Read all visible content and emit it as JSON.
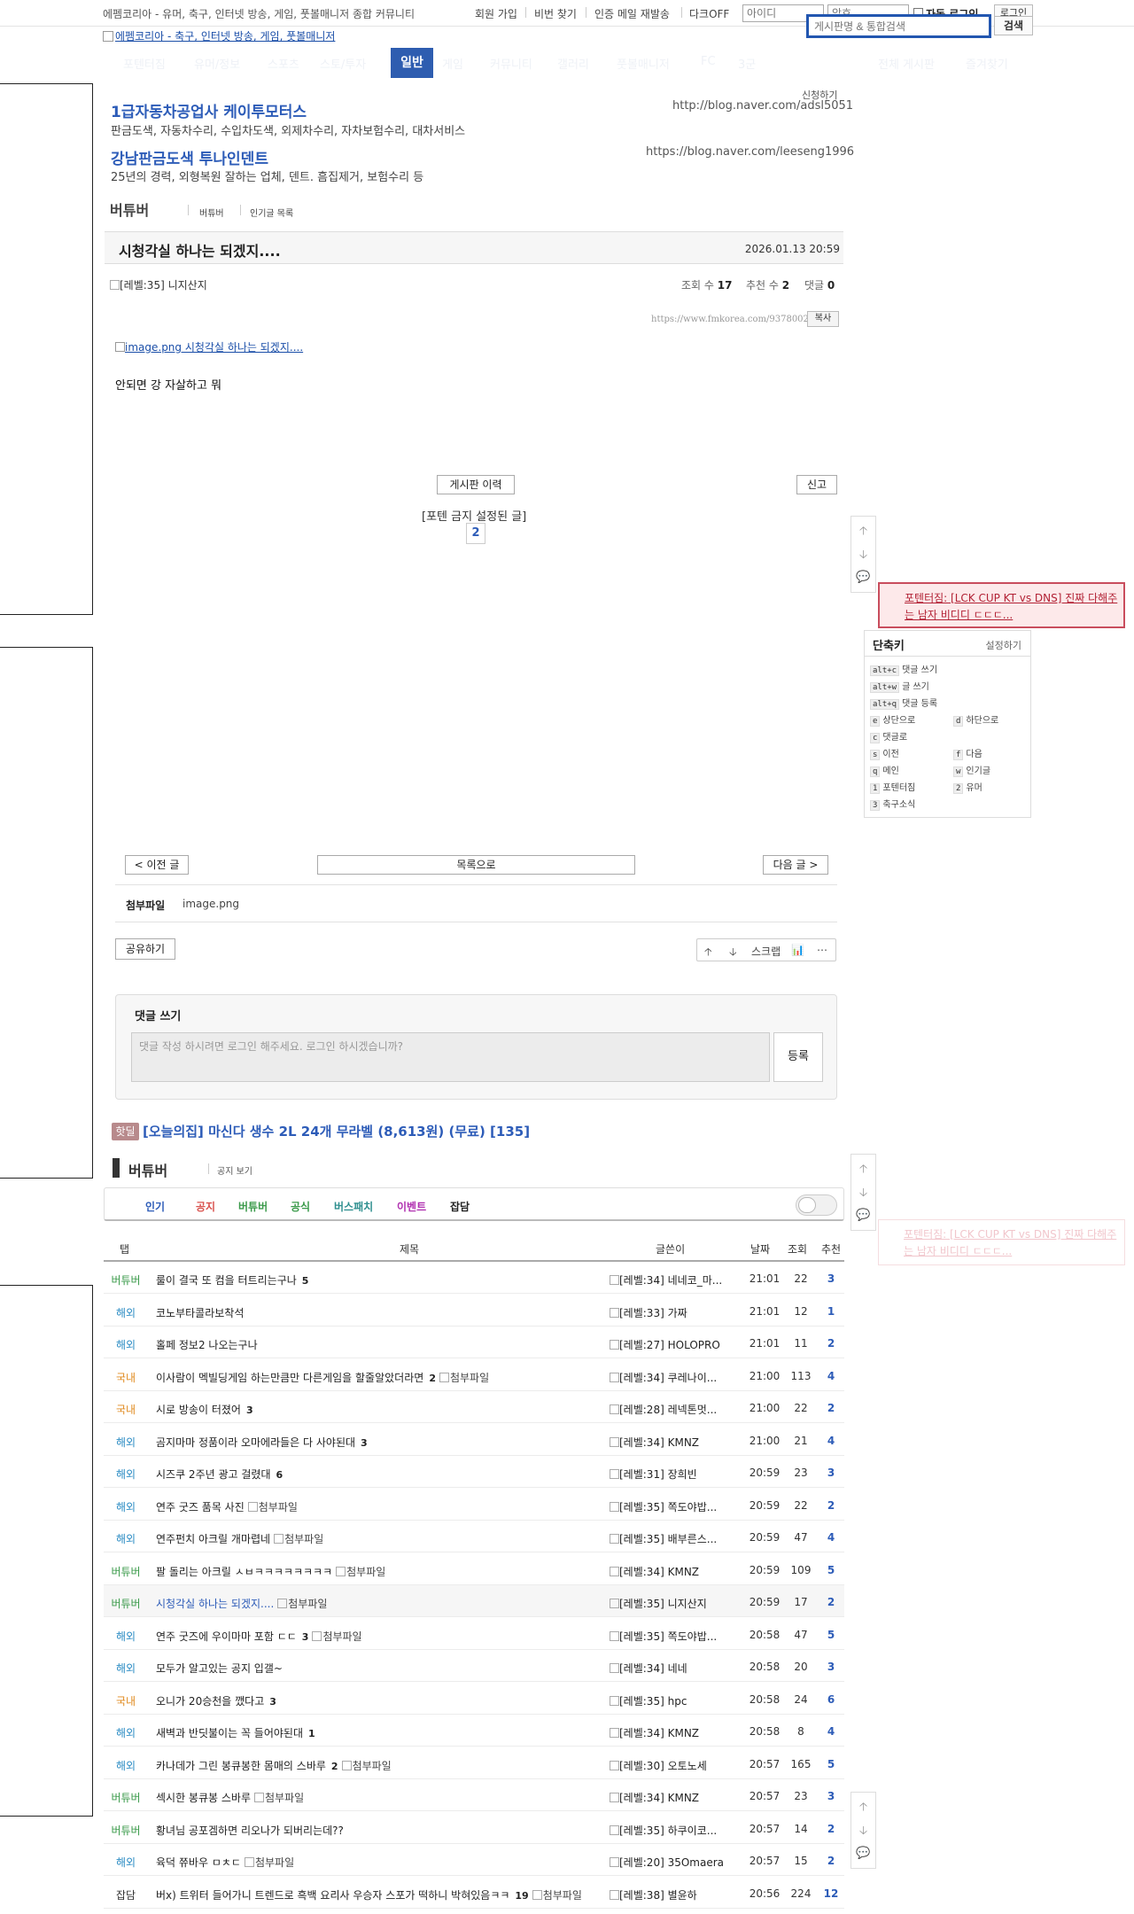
{
  "topbar": {
    "description": "에펨코리아 - 유머, 축구, 인터넷 방송, 게임, 풋볼매니저 종합 커뮤니티",
    "links": [
      "회원 가입",
      "비번 찾기",
      "인증 메일 재발송",
      "다크OFF"
    ],
    "id_placeholder": "아이디",
    "pw_placeholder": "암호",
    "autologin": "자동 로그인",
    "login": "로그인"
  },
  "logo": {
    "alt": "에펨코리아 - 축구, 인터넷 방송, 게임, 풋볼매니저"
  },
  "search": {
    "placeholder": "게시판명 & 통합검색",
    "button": "검색"
  },
  "nav": {
    "items": [
      "포텐터짐",
      "유머/정보",
      "스포츠",
      "스토/투자",
      "게임",
      "커뮤니티",
      "갤러리",
      "풋볼매니저",
      "FC",
      "3군"
    ],
    "active": "일반",
    "right": [
      "전체 게시판",
      "즐겨찾기"
    ]
  },
  "ads": {
    "request": "신청하기",
    "items": [
      {
        "title": "1급자동차공업사 케이투모터스",
        "desc": "판금도색, 자동차수리, 수입차도색, 외제차수리, 자차보험수리, 대차서비스",
        "url": "http://blog.naver.com/adsl5051"
      },
      {
        "title": "강남판금도색 투나인덴트",
        "desc": "25년의 경력, 외형복원 잘하는 업체, 덴트. 흠집제거, 보험수리 등",
        "url": "https://blog.naver.com/leeseng1996"
      }
    ]
  },
  "board": {
    "name": "버튜버",
    "sub_links": [
      "버튜버",
      "인기글 목록"
    ]
  },
  "post": {
    "title": "시청각실 하나는 되겠지....",
    "date": "2026.01.13 20:59",
    "author_level": "[레벨:35]",
    "author": "니지산지",
    "views_label": "조회 수",
    "views": "17",
    "votes_label": "추천 수",
    "votes": "2",
    "comments_label": "댓글",
    "comments": "0",
    "permalink": "https://www.fmkorea.com/9378002834",
    "copy": "복사",
    "image_alt": "image.png 시청각실 하나는 되겠지....",
    "body": "안되면 강 자살하고 뭐",
    "history": "게시판 이력",
    "report": "신고",
    "banned_text": "[포텐 금지 설정된 글]",
    "recommend_count": "2",
    "prev": "< 이전 글",
    "list": "목록으로",
    "next": "다음 글 >",
    "attach_label": "첨부파일",
    "attach_file": "image.png",
    "share": "공유하기",
    "scrap": "스크랩",
    "comment_title": "댓글 쓰기",
    "comment_placeholder": "댓글 작성 하시려면 로그인 해주세요. 로그인 하시겠습니까?",
    "comment_submit": "등록"
  },
  "float_icons": [
    "arrow-up-icon",
    "arrow-down-icon",
    "comment-icon"
  ],
  "hot_popup": {
    "text": "포텐터짐: [LCK CUP KT vs DNS] 진짜 다해주는 남자 비디디 ㄷㄷㄷ..."
  },
  "shortcuts": {
    "title": "단축키",
    "settings": "설정하기",
    "items": [
      {
        "key": "alt+c",
        "label": "댓글 쓰기"
      },
      {
        "key": "alt+w",
        "label": "글 쓰기"
      },
      {
        "key": "alt+q",
        "label": "댓글 등록"
      },
      {
        "key": "e",
        "label": "상단으로"
      },
      {
        "key": "d",
        "label": "하단으로"
      },
      {
        "key": "c",
        "label": "댓글로"
      },
      {
        "key": "s",
        "label": "이전"
      },
      {
        "key": "f",
        "label": "다음"
      },
      {
        "key": "q",
        "label": "메인"
      },
      {
        "key": "w",
        "label": "인기글"
      },
      {
        "key": "1",
        "label": "포텐터짐"
      },
      {
        "key": "2",
        "label": "유머"
      },
      {
        "key": "3",
        "label": "축구소식"
      }
    ]
  },
  "hotdeal": {
    "tag": "핫딜",
    "title": "[오늘의집] 마신다 생수 2L 24개 무라벨 (8,613원) (무료) [135]"
  },
  "list": {
    "board_name": "버튜버",
    "notice_toggle": "공지 보기",
    "categories": [
      {
        "label": "인기",
        "color": "#2d5cb8"
      },
      {
        "label": "공지",
        "color": "#d9534f"
      },
      {
        "label": "버튜버",
        "color": "#3a9a4a"
      },
      {
        "label": "공식",
        "color": "#3a9a4a"
      },
      {
        "label": "버스패치",
        "color": "#2f8f8f"
      },
      {
        "label": "이벤트",
        "color": "#b030b0"
      },
      {
        "label": "잡담",
        "color": "#222222"
      }
    ],
    "headers": [
      "탭",
      "제목",
      "글쓴이",
      "날짜",
      "조회",
      "추천"
    ],
    "attach_alt": "첨부파일",
    "rows": [
      {
        "cat": "버튜버",
        "cat_color": "#3a9a4a",
        "title": "룰이 결국 또 컴을 터트리는구나",
        "cc": "5",
        "att": false,
        "level": "[레벨:34]",
        "author": "네네코_마...",
        "time": "21:01",
        "views": "22",
        "votes": "3"
      },
      {
        "cat": "해외",
        "cat_color": "#2b8cc4",
        "title": "코노부타콜라보착석",
        "cc": "",
        "att": false,
        "level": "[레벨:33]",
        "author": "가짜",
        "time": "21:01",
        "views": "12",
        "votes": "1"
      },
      {
        "cat": "해외",
        "cat_color": "#2b8cc4",
        "title": "홀페 정보2 나오는구나",
        "cc": "",
        "att": false,
        "level": "[레벨:27]",
        "author": "HOLOPRO",
        "time": "21:01",
        "views": "11",
        "votes": "2"
      },
      {
        "cat": "국내",
        "cat_color": "#e08a1e",
        "title": "이사람이 멕빌딩게임 하는만큼만 다른게임을 할줄알았더라면",
        "cc": "2",
        "att": true,
        "level": "[레벨:34]",
        "author": "쿠레나이...",
        "time": "21:00",
        "views": "113",
        "votes": "4"
      },
      {
        "cat": "국내",
        "cat_color": "#e08a1e",
        "title": "시로 방송이 터졌어",
        "cc": "3",
        "att": false,
        "level": "[레벨:28]",
        "author": "레넥톤멋...",
        "time": "21:00",
        "views": "22",
        "votes": "2"
      },
      {
        "cat": "해외",
        "cat_color": "#2b8cc4",
        "title": "곰지마마 정품이라 오마에라들은 다 사야된대",
        "cc": "3",
        "att": false,
        "level": "[레벨:34]",
        "author": "KMNZ",
        "time": "21:00",
        "views": "21",
        "votes": "4"
      },
      {
        "cat": "해외",
        "cat_color": "#2b8cc4",
        "title": "시즈쿠 2주년 광고 걸렸대",
        "cc": "6",
        "att": false,
        "level": "[레벨:31]",
        "author": "장희빈",
        "time": "20:59",
        "views": "23",
        "votes": "3"
      },
      {
        "cat": "해외",
        "cat_color": "#2b8cc4",
        "title": "연주 굿즈 품목 사진",
        "cc": "",
        "att": true,
        "level": "[레벨:35]",
        "author": "쪽도야밥...",
        "time": "20:59",
        "views": "22",
        "votes": "2"
      },
      {
        "cat": "해외",
        "cat_color": "#2b8cc4",
        "title": "연주펀치 아크릴 개마렵네",
        "cc": "",
        "att": true,
        "level": "[레벨:35]",
        "author": "배부른스...",
        "time": "20:59",
        "views": "47",
        "votes": "4"
      },
      {
        "cat": "버튜버",
        "cat_color": "#3a9a4a",
        "title": "팔 돌리는 아크릴 ㅅㅂㅋㅋㅋㅋㅋㅋㅋㅋ",
        "cc": "",
        "att": true,
        "level": "[레벨:34]",
        "author": "KMNZ",
        "time": "20:59",
        "views": "109",
        "votes": "5"
      },
      {
        "cat": "버튜버",
        "cat_color": "#3a9a4a",
        "title": "시청각실 하나는 되겠지....",
        "cc": "",
        "att": true,
        "level": "[레벨:35]",
        "author": "니지산지",
        "time": "20:59",
        "views": "17",
        "votes": "2",
        "current": true
      },
      {
        "cat": "해외",
        "cat_color": "#2b8cc4",
        "title": "연주 굿즈에 우이마마 포함 ㄷㄷ",
        "cc": "3",
        "att": true,
        "level": "[레벨:35]",
        "author": "쪽도야밥...",
        "time": "20:58",
        "views": "47",
        "votes": "5"
      },
      {
        "cat": "해외",
        "cat_color": "#2b8cc4",
        "title": "모두가 알고있는 공지 입갤~",
        "cc": "",
        "att": false,
        "level": "[레벨:34]",
        "author": "네네",
        "time": "20:58",
        "views": "20",
        "votes": "3"
      },
      {
        "cat": "국내",
        "cat_color": "#e08a1e",
        "title": "오니가 20승천을 깼다고",
        "cc": "3",
        "att": false,
        "level": "[레벨:35]",
        "author": "hpc",
        "time": "20:58",
        "views": "24",
        "votes": "6"
      },
      {
        "cat": "해외",
        "cat_color": "#2b8cc4",
        "title": "새벽과 반딧불이는 꼭 들어야된대",
        "cc": "1",
        "att": false,
        "level": "[레벨:34]",
        "author": "KMNZ",
        "time": "20:58",
        "views": "8",
        "votes": "4"
      },
      {
        "cat": "해외",
        "cat_color": "#2b8cc4",
        "title": "카나데가 그린 봉큐봉한 몸매의 스바루",
        "cc": "2",
        "att": true,
        "level": "[레벨:30]",
        "author": "오토노세",
        "time": "20:57",
        "views": "165",
        "votes": "5"
      },
      {
        "cat": "버튜버",
        "cat_color": "#3a9a4a",
        "title": "섹시한 봉큐봉 스바루",
        "cc": "",
        "att": true,
        "level": "[레벨:34]",
        "author": "KMNZ",
        "time": "20:57",
        "views": "23",
        "votes": "3"
      },
      {
        "cat": "버튜버",
        "cat_color": "#3a9a4a",
        "title": "황녀님 공포겜하면 리오나가 되버리는데??",
        "cc": "",
        "att": false,
        "level": "[레벨:35]",
        "author": "하쿠이코...",
        "time": "20:57",
        "views": "14",
        "votes": "2"
      },
      {
        "cat": "해외",
        "cat_color": "#2b8cc4",
        "title": "육덕 쮸바우 ㅁㅊㄷ",
        "cc": "",
        "att": true,
        "level": "[레벨:20]",
        "author": "35Omaera",
        "time": "20:57",
        "views": "15",
        "votes": "2"
      },
      {
        "cat": "잡담",
        "cat_color": "#333333",
        "title": "버x) 트위터 들어가니 트렌드로 흑백 요리사 우승자 스포가 떡하니 박혀있음ㅋㅋ",
        "cc": "19",
        "att": true,
        "level": "[레벨:38]",
        "author": "별윤하",
        "time": "20:56",
        "views": "224",
        "votes": "12"
      }
    ]
  }
}
